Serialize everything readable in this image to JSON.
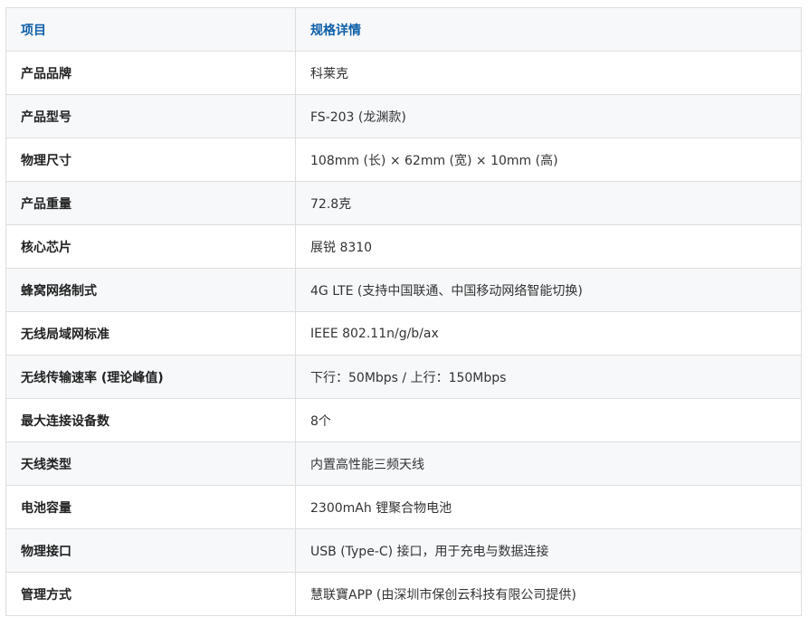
{
  "table": {
    "headers": [
      "项目",
      "规格详情"
    ],
    "rows": [
      {
        "item": "产品品牌",
        "value": "科莱克"
      },
      {
        "item": "产品型号",
        "value": "FS-203 (龙渊款)"
      },
      {
        "item": "物理尺寸",
        "value": "108mm (长) × 62mm (宽) × 10mm (高)"
      },
      {
        "item": "产品重量",
        "value": "72.8克"
      },
      {
        "item": "核心芯片",
        "value": "展锐 8310"
      },
      {
        "item": "蜂窝网络制式",
        "value": "4G LTE (支持中国联通、中国移动网络智能切换)"
      },
      {
        "item": "无线局域网标准",
        "value": "IEEE 802.11n/g/b/ax"
      },
      {
        "item": "无线传输速率 (理论峰值)",
        "value": "下行：50Mbps / 上行：150Mbps"
      },
      {
        "item": "最大连接设备数",
        "value": "8个"
      },
      {
        "item": "天线类型",
        "value": "内置高性能三频天线"
      },
      {
        "item": "电池容量",
        "value": "2300mAh 锂聚合物电池"
      },
      {
        "item": "物理接口",
        "value": "USB (Type-C) 接口，用于充电与数据连接"
      },
      {
        "item": "管理方式",
        "value": "慧联寶APP (由深圳市保创云科技有限公司提供)"
      }
    ]
  },
  "colors": {
    "header_text": "#0f5fa8",
    "header_bg": "#f6f8fa",
    "stripe_bg": "#f6f8fa",
    "border": "#dedede"
  }
}
